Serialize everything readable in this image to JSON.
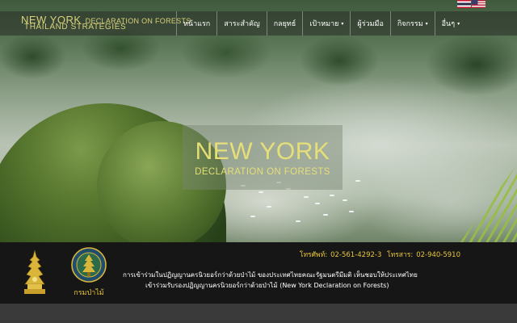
{
  "header": {
    "logo": {
      "line1_big": "NEW YORK",
      "line1_small": "DECLARATION ON FORESTS",
      "line2": "THAILAND STRATEGIES"
    },
    "languages": [
      {
        "icon": "thai-flag-icon"
      },
      {
        "icon": "us-flag-icon"
      }
    ]
  },
  "nav": {
    "items": [
      {
        "label": "หน้าแรก",
        "has_dropdown": false
      },
      {
        "label": "สาระสำคัญ",
        "has_dropdown": false
      },
      {
        "label": "กลยุทธ์",
        "has_dropdown": false
      },
      {
        "label": "เป้าหมาย",
        "has_dropdown": true
      },
      {
        "label": "ผู้ร่วมมือ",
        "has_dropdown": false
      },
      {
        "label": "กิจกรรม",
        "has_dropdown": true
      },
      {
        "label": "อื่นๆ",
        "has_dropdown": true
      }
    ],
    "caret": "▾"
  },
  "hero": {
    "title": "NEW YORK",
    "subtitle": "DECLARATION ON FORESTS"
  },
  "footer": {
    "phone_label": "โทรศัพท์:",
    "phone": "02-561-4292-3",
    "fax_label": "โทรสาร:",
    "fax": "02-940-5910",
    "line1": "การเข้าร่วมในปฏิญญานครนิวยอร์กว่าด้วยป่าไม้  ของประเทศไทยคณะรัฐมนตรีมีมติ  เห็นชอบให้ประเทศไทย",
    "line2": "เข้าร่วมรับรองปฏิญญานครนิวยอร์กว่าด้วยป่าไม้ (New York Declaration on Forests)",
    "seal_label": "กรมป่าไม้"
  },
  "colors": {
    "accent_gold": "#e6df78",
    "footer_gold": "#e8c53a",
    "footer_bg": "#161616"
  }
}
